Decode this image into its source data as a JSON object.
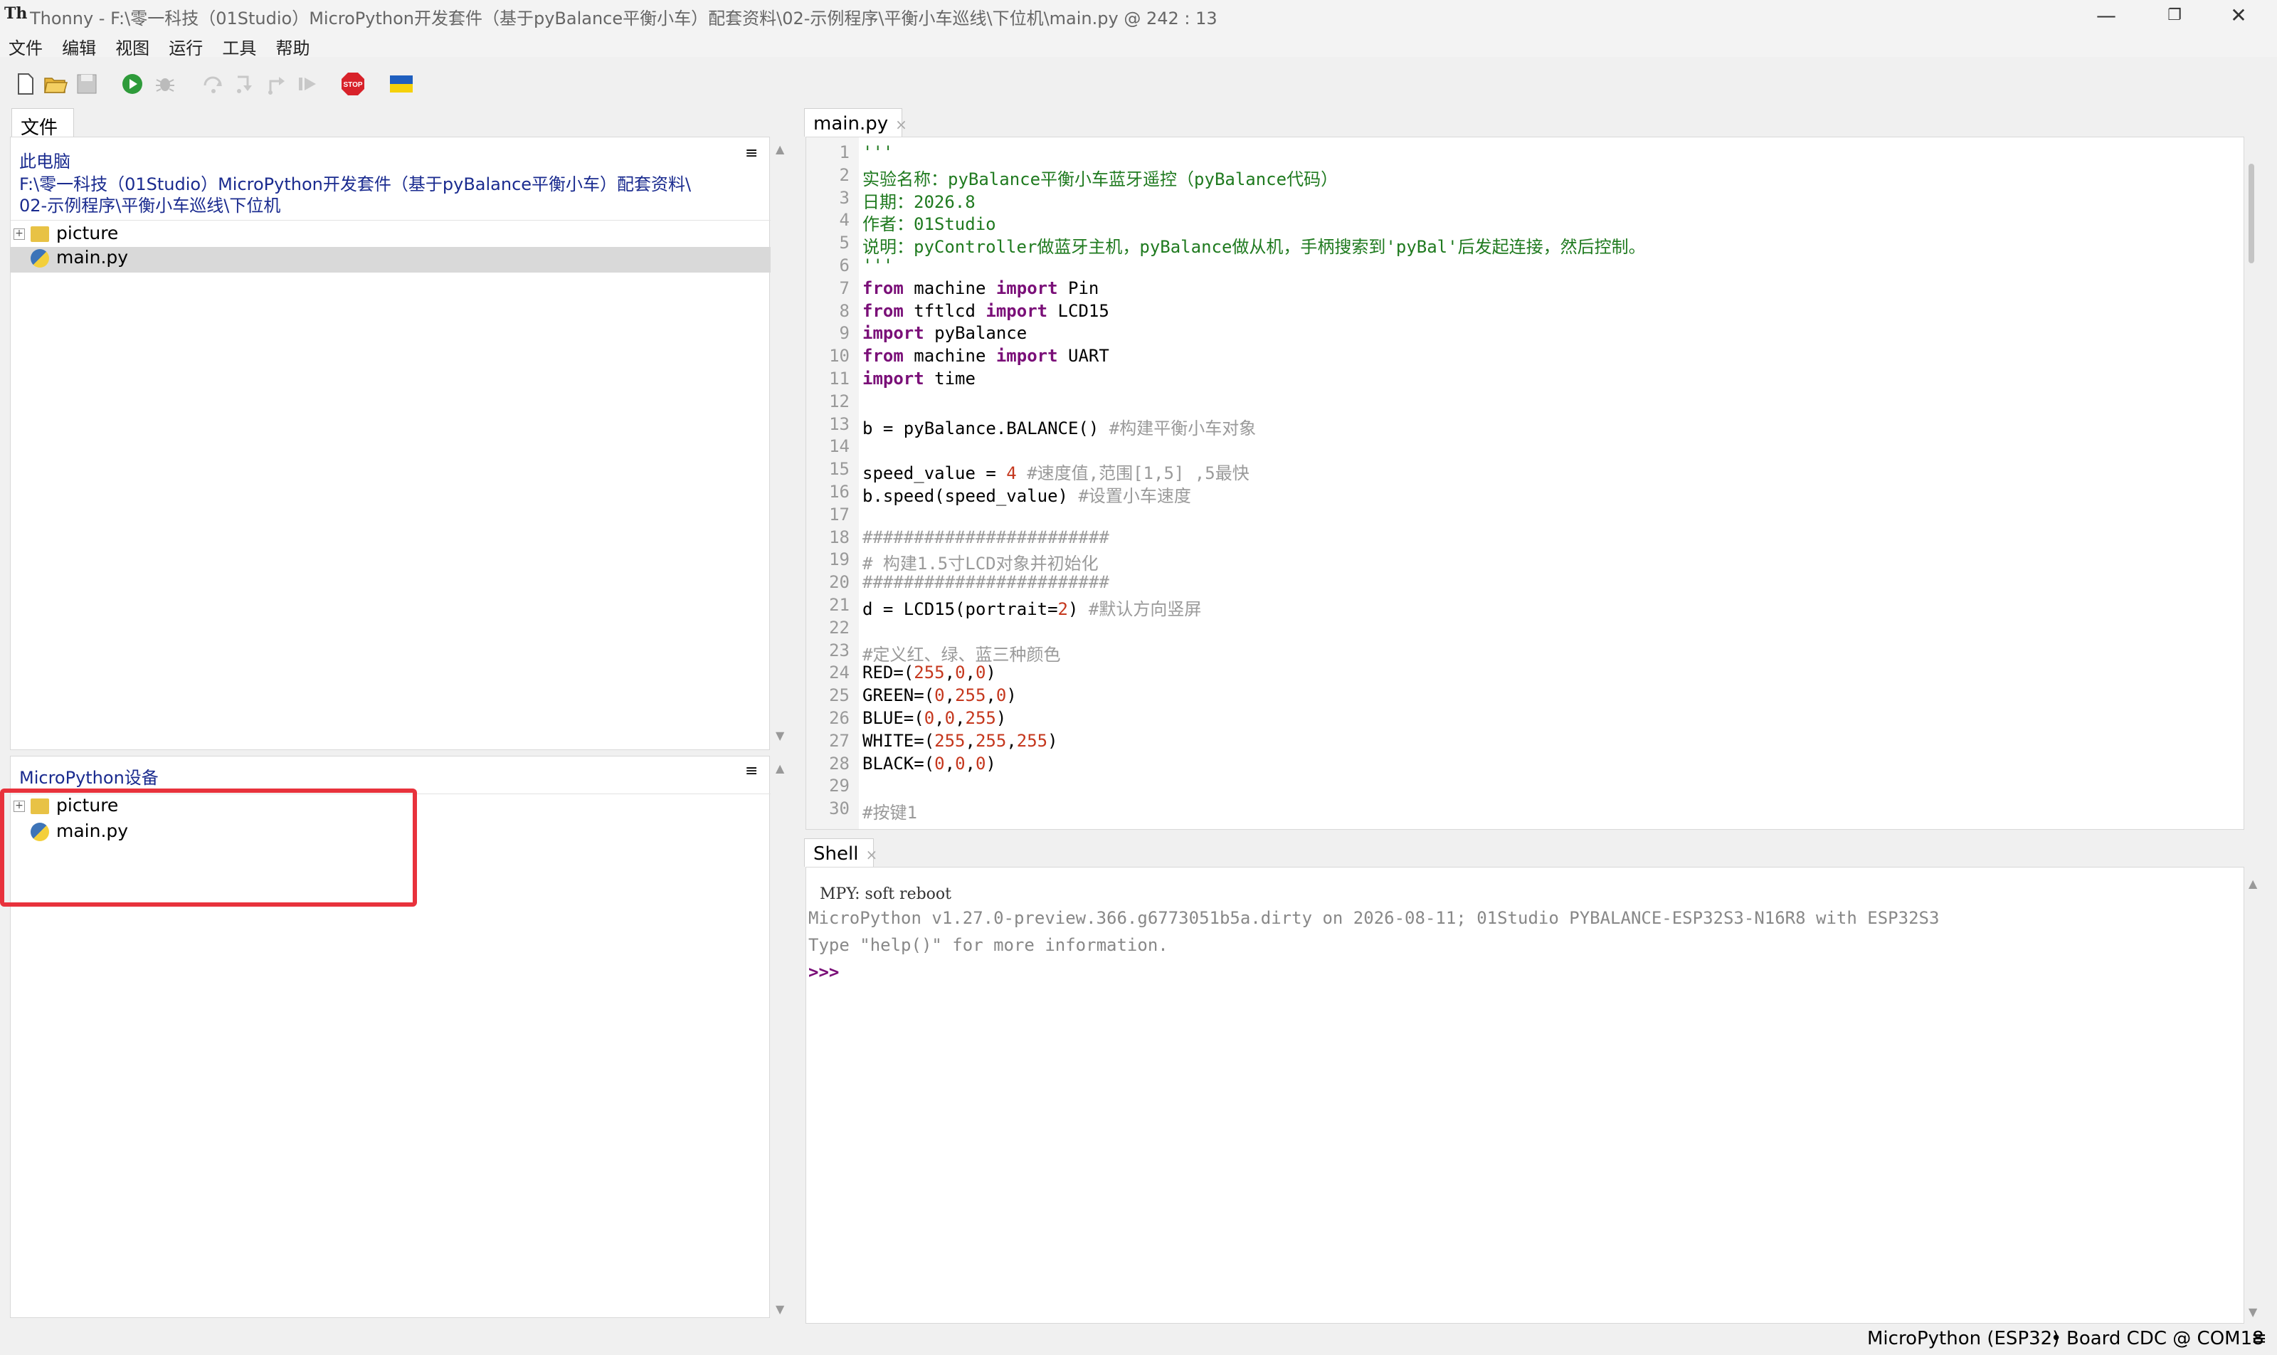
{
  "window": {
    "title": "Thonny  -  F:\\零一科技（01Studio）MicroPython开发套件（基于pyBalance平衡小车）配套资料\\02-示例程序\\平衡小车巡线\\下位机\\main.py  @  242 : 13",
    "minimize": "—",
    "restore": "❐",
    "close": "✕"
  },
  "menu": [
    "文件",
    "编辑",
    "视图",
    "运行",
    "工具",
    "帮助"
  ],
  "toolbar": {
    "icons": [
      "new-file-icon",
      "open-file-icon",
      "save-icon",
      "run-icon",
      "debug-icon",
      "step-over-icon",
      "step-into-icon",
      "step-out-icon",
      "resume-icon",
      "stop-icon",
      "ukraine-flag-icon"
    ],
    "stop_label": "STOP"
  },
  "files_pane": {
    "tab": "文件",
    "tab_close": "×",
    "menu_glyph": "≡",
    "this_pc": "此电脑",
    "path_line1": "F:\\零一科技（01Studio）MicroPython开发套件（基于pyBalance平衡小车）配套资料\\",
    "path_line2": "02-示例程序\\平衡小车巡线\\下位机",
    "items": [
      {
        "name": "picture",
        "type": "folder"
      },
      {
        "name": "main.py",
        "type": "python"
      }
    ]
  },
  "device_pane": {
    "title": "MicroPython设备",
    "menu_glyph": "≡",
    "items": [
      {
        "name": "picture",
        "type": "folder"
      },
      {
        "name": "main.py",
        "type": "python"
      }
    ]
  },
  "editor": {
    "tab": "main.py",
    "tab_close": "×",
    "line_numbers": [
      "1",
      "2",
      "3",
      "4",
      "5",
      "6",
      "7",
      "8",
      "9",
      "10",
      "11",
      "12",
      "13",
      "14",
      "15",
      "16",
      "17",
      "18",
      "19",
      "20",
      "21",
      "22",
      "23",
      "24",
      "25",
      "26",
      "27",
      "28",
      "29",
      "30"
    ]
  },
  "shell": {
    "tab": "Shell",
    "tab_close": "×",
    "line1": "MPY: soft reboot",
    "line2": "MicroPython v1.27.0-preview.366.g6773051b5a.dirty on 2026-08-11; 01Studio PYBALANCE-ESP32S3-N16R8 with ESP32S3",
    "line3": "Type \"help()\" for more information.",
    "prompt": ">>>"
  },
  "status": {
    "interpreter": "MicroPython (ESP32)",
    "separator": "•",
    "port": "Board CDC @ COM18",
    "menu_glyph": "≡"
  },
  "colors": {
    "highlight_box": "#e8323c",
    "keyword": "#7a0f78",
    "string": "#1f7a1f",
    "comment": "#9a9a9a",
    "number": "#c5371d",
    "path_text": "#1a2b8f",
    "prompt": "#7a0f78"
  }
}
